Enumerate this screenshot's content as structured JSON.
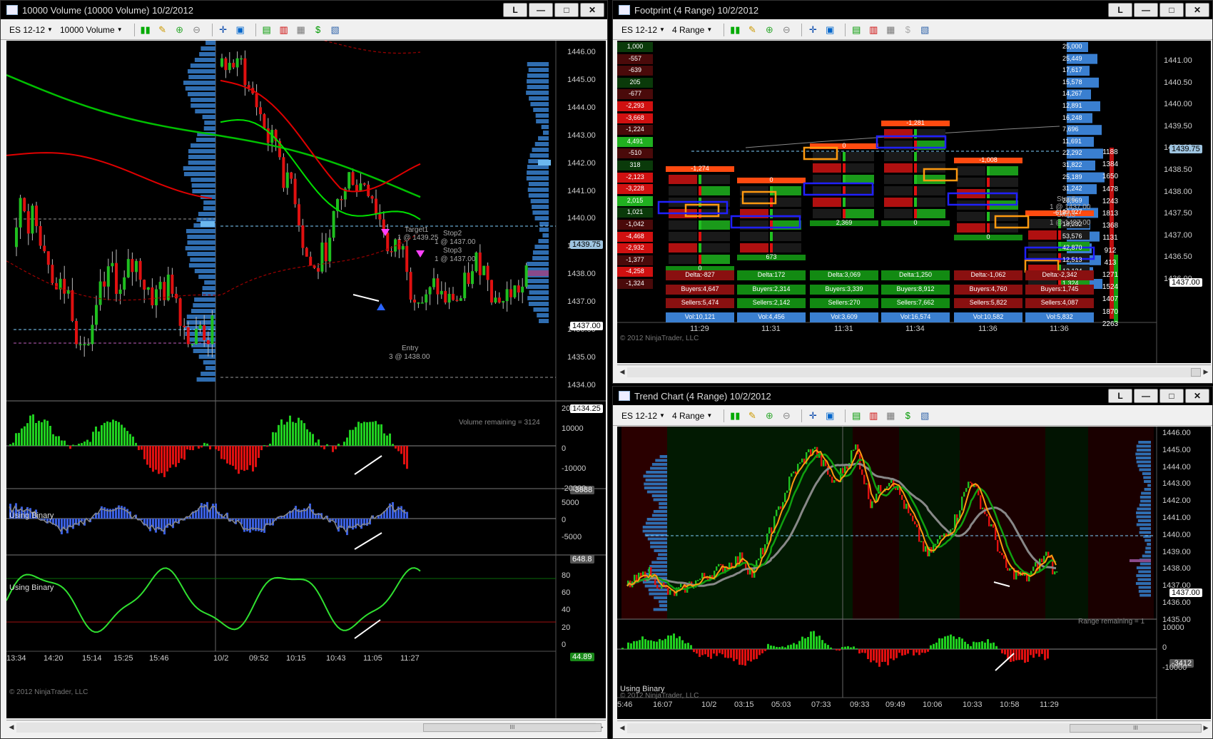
{
  "windows": {
    "volume": {
      "title": "10000 Volume (10000 Volume)  10/2/2012",
      "instrument": "ES 12-12",
      "period": "10000 Volume",
      "price_ticks": [
        "1446.00",
        "1445.00",
        "1444.00",
        "1443.00",
        "1442.00",
        "1441.00",
        "1440.00",
        "1439.00",
        "1438.00",
        "1437.00",
        "1436.00",
        "1435.00",
        "1434.00"
      ],
      "last_price": "1437.00",
      "target_price": "1439.75",
      "low_price": "1434.25",
      "volume_remaining": "Volume remaining = 3124",
      "target_label": "Target1",
      "target_detail": "1 @ 1439.25",
      "stop2_label": "Stop2",
      "stop2_detail": "1 @ 1437.00",
      "stop3_label": "Stop3",
      "stop3_detail": "1 @ 1437.00",
      "entry_label": "Entry",
      "entry_detail": "3 @ 1438.00",
      "panel2_label": "Using Binary",
      "panel2_ticks": [
        "20000",
        "10000",
        "0",
        "-10000",
        "-20000"
      ],
      "panel2_value": "-3988",
      "panel3_label": "Using Binary",
      "panel3_ticks": [
        "5000",
        "0",
        "-5000"
      ],
      "panel3_value": "648.8",
      "panel4_ticks": [
        "80",
        "60",
        "40",
        "20",
        "0"
      ],
      "panel4_value": "44.89",
      "copyright": "© 2012 NinjaTrader, LLC",
      "time_ticks": [
        "13:34",
        "14:20",
        "15:14",
        "15:25",
        "15:46",
        "10/2",
        "09:52",
        "10:15",
        "10:43",
        "11:05",
        "11:27"
      ]
    },
    "footprint": {
      "title": "Footprint (4 Range)  10/2/2012",
      "instrument": "ES 12-12",
      "period": "4 Range",
      "price_ticks": [
        "1441.00",
        "1440.50",
        "1440.00",
        "1439.50",
        "1439.00",
        "1438.50",
        "1438.00",
        "1437.50",
        "1437.00",
        "1436.50",
        "1436.00"
      ],
      "last_price": "1437.00",
      "target_price": "1439.75",
      "left_column": [
        "1,000",
        "-557",
        "-639",
        "205",
        "-677",
        "-2,293",
        "-3,668",
        "-1,224",
        "4,491",
        "-510",
        "318",
        "-2,123",
        "-3,228",
        "2,015",
        "1,021",
        "-1,042",
        "-4,468",
        "-2,932",
        "-1,377",
        "-4,258",
        "-1,324"
      ],
      "right_column": [
        "25,000",
        "25,449",
        "17,617",
        "15,578",
        "14,267",
        "12,891",
        "16,248",
        "7,696",
        "11,691",
        "22,292",
        "31,822",
        "25,189",
        "31,242",
        "28,969",
        "29,927",
        "18,232",
        "53,576",
        "42,870",
        "12,513",
        "12,134",
        "1,324"
      ],
      "far_right_column": [
        "1188",
        "1384",
        "1650",
        "1478",
        "1243",
        "1813",
        "1368",
        "1131",
        "912",
        "413",
        "1271",
        "1524",
        "1407",
        "1870",
        "2263"
      ],
      "bars": [
        {
          "time": "11:29",
          "delta": "Delta:-827",
          "buyers": "Buyers:4,647",
          "sellers": "Sellers:5,474",
          "vol": "Vol:10,121",
          "top": "-1,274",
          "bottom": "0"
        },
        {
          "time": "11:31",
          "delta": "Delta:172",
          "buyers": "Buyers:2,314",
          "sellers": "Sellers:2,142",
          "vol": "Vol:4,456",
          "top": "0",
          "bottom": "673"
        },
        {
          "time": "11:31",
          "delta": "Delta:3,069",
          "buyers": "Buyers:3,339",
          "sellers": "Sellers:270",
          "vol": "Vol:3,609",
          "top": "0",
          "bottom": "2,369"
        },
        {
          "time": "11:34",
          "delta": "Delta:1,250",
          "buyers": "Buyers:8,912",
          "sellers": "Sellers:7,662",
          "vol": "Vol:16,574",
          "top": "-1,281",
          "bottom": "0"
        },
        {
          "time": "11:36",
          "delta": "Delta:-1,062",
          "buyers": "Buyers:4,760",
          "sellers": "Sellers:5,822",
          "vol": "Vol:10,582",
          "top": "-1,008",
          "bottom": "0"
        },
        {
          "time": "11:36",
          "delta": "Delta:-2,342",
          "buyers": "Buyers:1,745",
          "sellers": "Sellers:4,087",
          "vol": "Vol:5,832",
          "top": "-619",
          "bottom": ""
        }
      ],
      "stop2_label": "Stop2",
      "stop2_detail": "1 @ 1437.00",
      "stop3_label": "Stop3",
      "stop3_detail": "1 @ 1437.00",
      "copyright": "© 2012 NinjaTrader, LLC"
    },
    "trend": {
      "title": "Trend Chart (4 Range)  10/2/2012",
      "instrument": "ES 12-12",
      "period": "4 Range",
      "price_ticks": [
        "1446.00",
        "1445.00",
        "1444.00",
        "1443.00",
        "1442.00",
        "1441.00",
        "1440.00",
        "1439.00",
        "1438.00",
        "1437.00",
        "1436.00",
        "1435.00"
      ],
      "last_price": "1437.00",
      "range_remaining": "Range remaining = 1",
      "panel2_label": "Using Binary",
      "panel2_ticks": [
        "10000",
        "0",
        "-10000"
      ],
      "panel2_value": "-3412",
      "copyright": "© 2012 NinjaTrader, LLC",
      "time_ticks": [
        "5:46",
        "16:07",
        "10/2",
        "03:15",
        "05:03",
        "07:33",
        "09:33",
        "09:49",
        "10:06",
        "10:33",
        "10:58",
        "11:29"
      ]
    }
  },
  "window_buttons": {
    "link": "L",
    "minimize": "—",
    "maximize": "□",
    "close": "✕"
  },
  "colors": {
    "up": "#1fbf1f",
    "down": "#e01010",
    "ema_green": "#00cc00",
    "ema_red": "#e00000",
    "target_line": "#7fd0ff",
    "blue_profile": "#3a7fd0"
  }
}
